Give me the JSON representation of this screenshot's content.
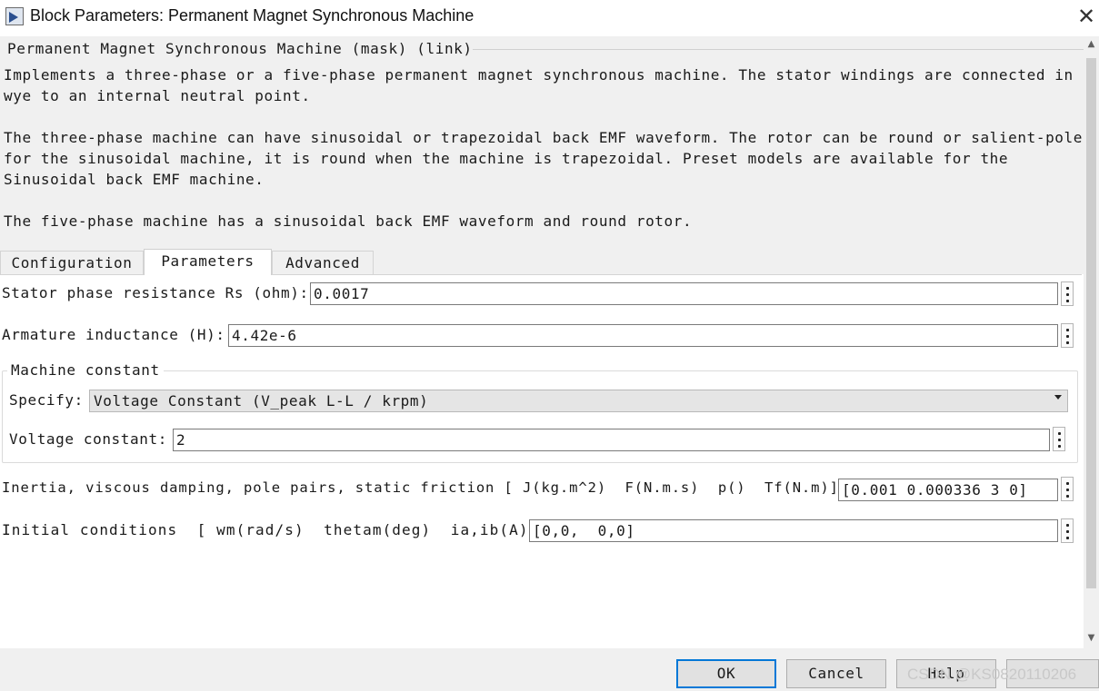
{
  "window": {
    "title": "Block Parameters: Permanent Magnet Synchronous Machine",
    "close_glyph": "✕"
  },
  "description": {
    "group_title": "Permanent Magnet Synchronous Machine (mask) (link)",
    "lines": [
      "Implements a three-phase or a five-phase permanent magnet synchronous machine. The stator windings are connected in",
      "wye to an internal neutral point.",
      "",
      "The three-phase machine can have sinusoidal or trapezoidal back EMF waveform. The rotor can be round or salient-pole",
      "for the sinusoidal machine, it is round when the machine is trapezoidal. Preset models are available for the",
      "Sinusoidal back EMF machine.",
      "",
      "The five-phase machine has a sinusoidal back EMF waveform and round rotor."
    ]
  },
  "tabs": [
    {
      "label": "Configuration",
      "active": false
    },
    {
      "label": "Parameters",
      "active": true
    },
    {
      "label": "Advanced",
      "active": false
    }
  ],
  "params": {
    "rs_label": "Stator phase resistance Rs (ohm):",
    "rs_value": "0.0017",
    "la_label": "Armature inductance (H):",
    "la_value": "4.42e-6",
    "machine_constant": {
      "group_title": "Machine constant",
      "specify_label": "Specify:",
      "specify_value": "Voltage Constant (V_peak L-L / krpm)",
      "voltage_label": "Voltage constant:",
      "voltage_value": "2"
    },
    "inertia_label": "Inertia, viscous damping, pole pairs, static friction [ J(kg.m^2)  F(N.m.s)  p()  Tf(N.m)]:",
    "inertia_value": "[0.001 0.000336 3 0]",
    "initial_label": "Initial conditions  [ wm(rad/s)  thetam(deg)  ia,ib(A) ]:",
    "initial_value": "[0,0,  0,0]"
  },
  "buttons": {
    "ok": "OK",
    "cancel": "Cancel",
    "help": "Help"
  },
  "watermark": "CSDN @KS0820110206"
}
